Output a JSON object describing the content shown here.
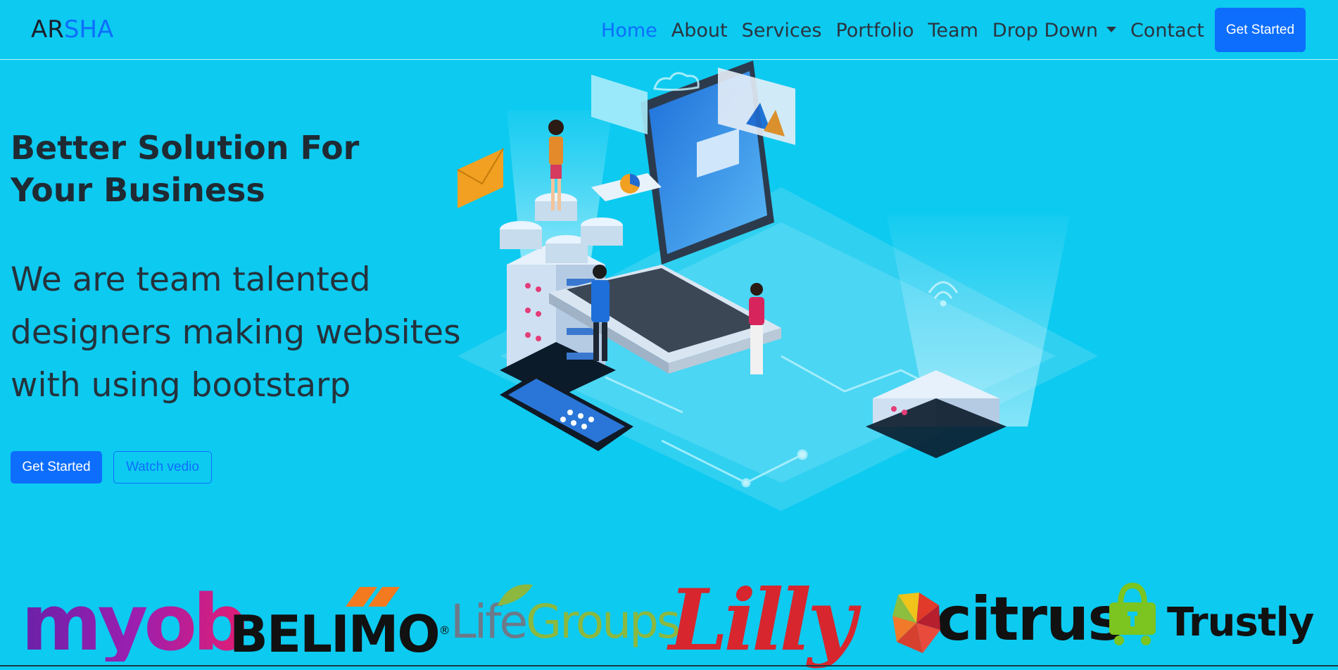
{
  "brand": {
    "left": "AR",
    "right": "SHA"
  },
  "nav": {
    "items": [
      {
        "label": "Home",
        "active": true
      },
      {
        "label": "About",
        "active": false
      },
      {
        "label": "Services",
        "active": false
      },
      {
        "label": "Portfolio",
        "active": false
      },
      {
        "label": "Team",
        "active": false
      },
      {
        "label": "Drop Down",
        "active": false,
        "dropdown": true
      },
      {
        "label": "Contact",
        "active": false
      }
    ],
    "cta": "Get Started"
  },
  "hero": {
    "title": "Better Solution For Your Business",
    "subtitle": "We are team talented designers making websites with using bootstarp",
    "primary_button": "Get Started",
    "secondary_button": "Watch vedio"
  },
  "clients": [
    {
      "name": "myob"
    },
    {
      "name": "BELIMO",
      "mark": "®"
    },
    {
      "name_a": "Life",
      "name_b": "Groups"
    },
    {
      "name": "Lilly"
    },
    {
      "name": "citrus"
    },
    {
      "name": "Trustly"
    }
  ],
  "colors": {
    "background": "#0dcaf0",
    "primary": "#0d6efd",
    "text": "#212529"
  }
}
